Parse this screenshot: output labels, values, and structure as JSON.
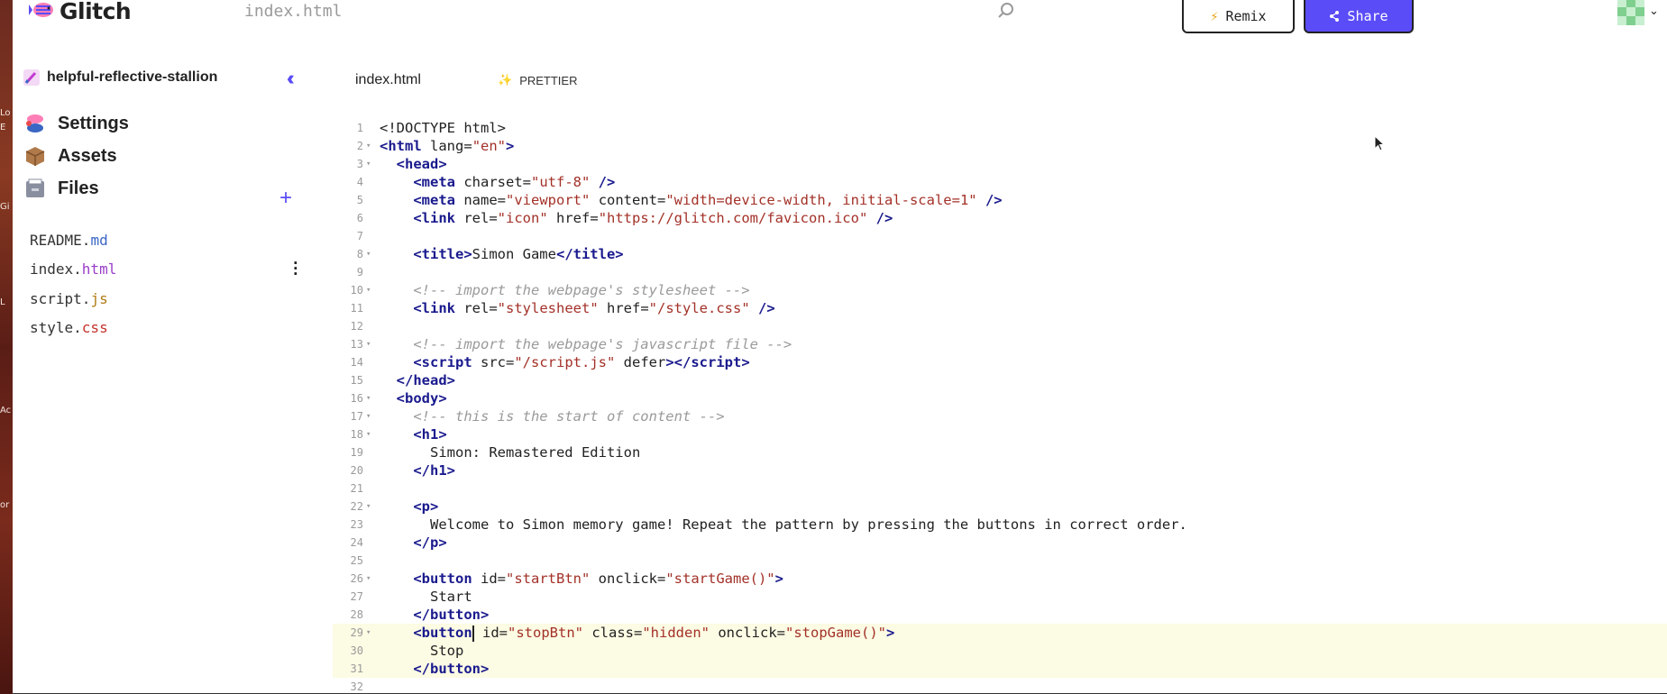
{
  "header": {
    "logo_text": "Glitch",
    "file_title": "index.html",
    "remix_label": "Remix",
    "remix_icon": "lightning-icon",
    "share_label": "Share",
    "share_icon": "share-icon",
    "search_icon": "search-icon",
    "accent_color": "#5a4cf7"
  },
  "sidebar": {
    "project_name": "helpful-reflective-stallion",
    "collapse_icon": "double-chevron-left-icon",
    "nav": [
      {
        "label": "Settings",
        "icon": "settings-fish-icon"
      },
      {
        "label": "Assets",
        "icon": "box-icon"
      },
      {
        "label": "Files",
        "icon": "file-cabinet-icon"
      }
    ],
    "add_icon": "plus-icon",
    "files": [
      {
        "base": "README.",
        "ext": "md"
      },
      {
        "base": "index.",
        "ext": "html"
      },
      {
        "base": "script.",
        "ext": "js"
      },
      {
        "base": "style.",
        "ext": "css"
      }
    ]
  },
  "editor": {
    "tab_label": "index.html",
    "prettier_label": "PRETTIER",
    "line_numbers": [
      "1",
      "2",
      "3",
      "4",
      "5",
      "6",
      "7",
      "8",
      "9",
      "10",
      "11",
      "12",
      "13",
      "14",
      "15",
      "16",
      "17",
      "18",
      "19",
      "20",
      "21",
      "22",
      "23",
      "24",
      "25",
      "26",
      "27",
      "28",
      "29",
      "30",
      "31",
      "32"
    ]
  },
  "desktop": {
    "fragments": [
      "Lo",
      "E",
      "Gi",
      "L",
      "Ac",
      "or"
    ]
  }
}
